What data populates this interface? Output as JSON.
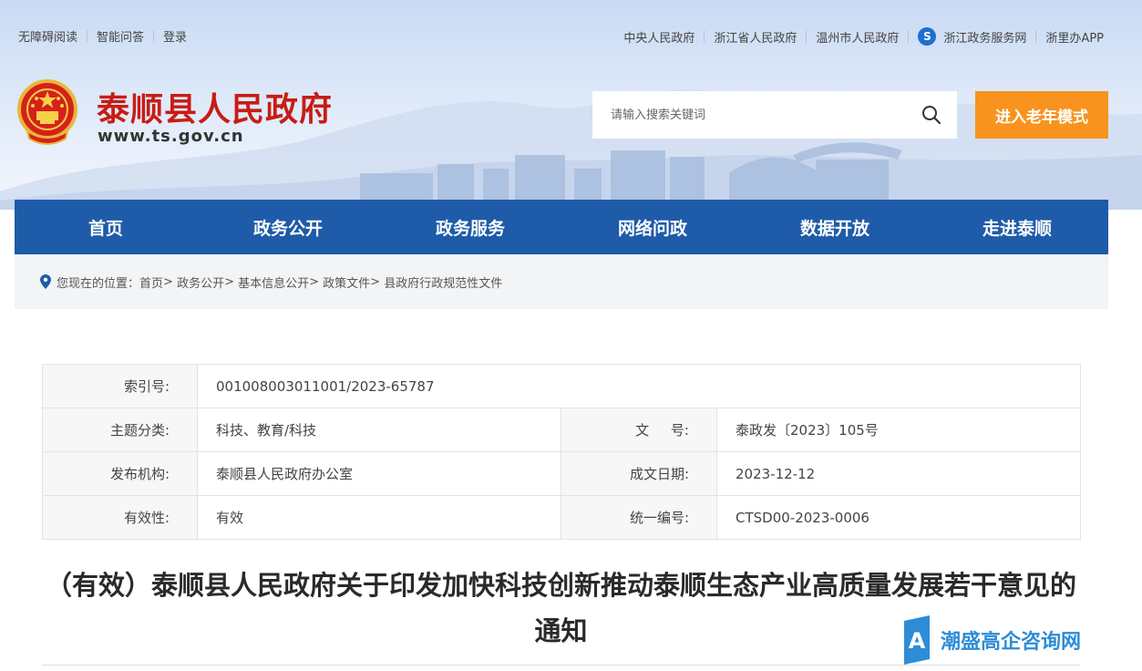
{
  "top_bar": {
    "left_links": [
      "无障碍阅读",
      "智能问答",
      "登录"
    ],
    "right_links": [
      "中央人民政府",
      "浙江省人民政府",
      "温州市人民政府",
      "浙江政务服务网",
      "浙里办APP"
    ]
  },
  "header": {
    "title": "泰顺县人民政府",
    "url": "www.ts.gov.cn",
    "search_placeholder": "请输入搜索关键词",
    "elder_mode_label": "进入老年模式"
  },
  "nav": {
    "items": [
      "首页",
      "政务公开",
      "政务服务",
      "网络问政",
      "数据开放",
      "走进泰顺"
    ]
  },
  "breadcrumb": {
    "prefix": "您现在的位置：",
    "items": [
      "首页",
      "政务公开",
      "基本信息公开",
      "政策文件",
      "县政府行政规范性文件"
    ]
  },
  "meta": {
    "index_label": "索引号:",
    "index_value": "001008003011001/2023-65787",
    "topic_label": "主题分类:",
    "topic_value": "科技、教育/科技",
    "docno_label": "文     号:",
    "docno_value": "泰政发〔2023〕105号",
    "issuer_label": "发布机构:",
    "issuer_value": "泰顺县人民政府办公室",
    "date_label": "成文日期:",
    "date_value": "2023-12-12",
    "validity_label": "有效性:",
    "validity_value": "有效",
    "code_label": "统一编号:",
    "code_value": "CTSD00-2023-0006"
  },
  "document": {
    "title": "（有效）泰顺县人民政府关于印发加快科技创新推动泰顺生态产业高质量发展若干意见的通知"
  },
  "watermark": {
    "text": "潮盛高企咨询网"
  },
  "colors": {
    "nav_bg": "#1e5ba8",
    "title_red": "#c81c14",
    "elder_btn": "#f7931e",
    "watermark_blue": "#2d8cd6"
  }
}
